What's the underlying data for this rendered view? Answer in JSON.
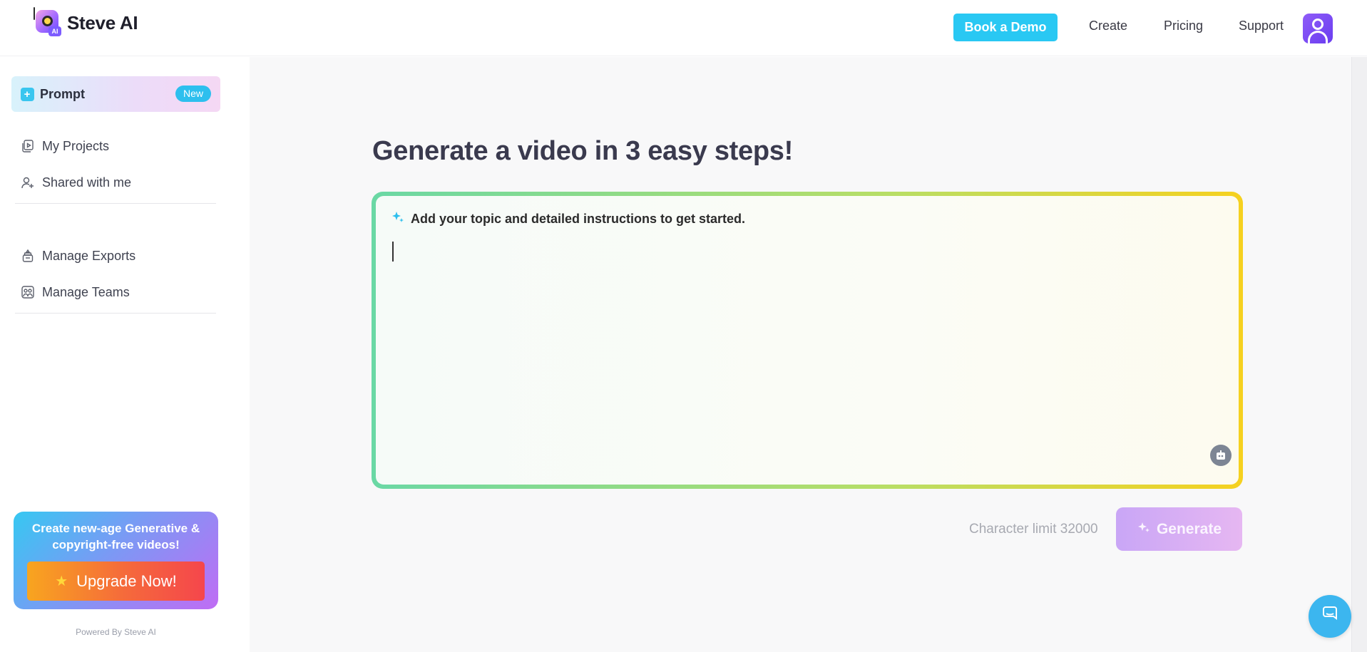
{
  "app": {
    "name": "Steve AI",
    "logo_badge": "AI"
  },
  "header": {
    "book_demo_label": "Book a Demo",
    "nav": {
      "create": "Create",
      "pricing": "Pricing",
      "support": "Support"
    }
  },
  "sidebar": {
    "prompt": {
      "label": "Prompt",
      "badge": "New"
    },
    "items": [
      {
        "label": "My Projects",
        "icon": "projects-icon"
      },
      {
        "label": "Shared with me",
        "icon": "user-plus-icon"
      },
      {
        "label": "Manage Exports",
        "icon": "exports-icon"
      },
      {
        "label": "Manage Teams",
        "icon": "teams-icon"
      }
    ],
    "promo": {
      "text": "Create new-age Generative & copyright-free videos!",
      "button_label": "Upgrade Now!"
    },
    "powered_by": "Powered By Steve AI"
  },
  "main": {
    "title": "Generate a video in 3 easy steps!",
    "prompt_box": {
      "instruction": "Add your topic and detailed instructions to get started.",
      "value": ""
    },
    "char_limit_text": "Character limit 32000",
    "generate_label": "Generate"
  },
  "colors": {
    "accent_blue": "#29c8f3",
    "purple": "#7d5cff",
    "border_gradient_start": "#6ad8a5",
    "border_gradient_end": "#f6d11f"
  }
}
